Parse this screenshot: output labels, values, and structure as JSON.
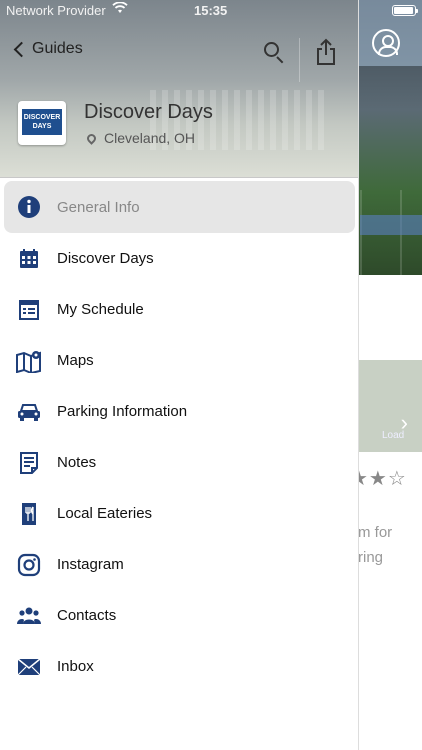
{
  "status_bar": {
    "provider": "Network Provider",
    "time": "15:35",
    "wifi_icon": "wifi-icon",
    "battery_icon": "battery-icon"
  },
  "header": {
    "back_label": "Guides",
    "title": "Discover Days",
    "location": "Cleveland, OH",
    "logo_text": "DISCOVER DAYS"
  },
  "menu": {
    "items": [
      {
        "label": "General Info",
        "icon": "info-icon",
        "active": true
      },
      {
        "label": "Discover Days",
        "icon": "calendar-icon"
      },
      {
        "label": "My Schedule",
        "icon": "schedule-icon"
      },
      {
        "label": "Maps",
        "icon": "map-icon"
      },
      {
        "label": "Parking Information",
        "icon": "car-icon"
      },
      {
        "label": "Notes",
        "icon": "note-icon"
      },
      {
        "label": "Local Eateries",
        "icon": "restaurant-icon"
      },
      {
        "label": "Instagram",
        "icon": "instagram-icon"
      },
      {
        "label": "Contacts",
        "icon": "contacts-icon"
      },
      {
        "label": "Inbox",
        "icon": "mail-icon"
      }
    ]
  },
  "background": {
    "text_line1": "m for",
    "text_line2": "ring",
    "banner_small": "Load",
    "stars": "★★☆"
  },
  "colors": {
    "accent": "#1f3f7a",
    "active_bg": "#e6e6e6"
  }
}
